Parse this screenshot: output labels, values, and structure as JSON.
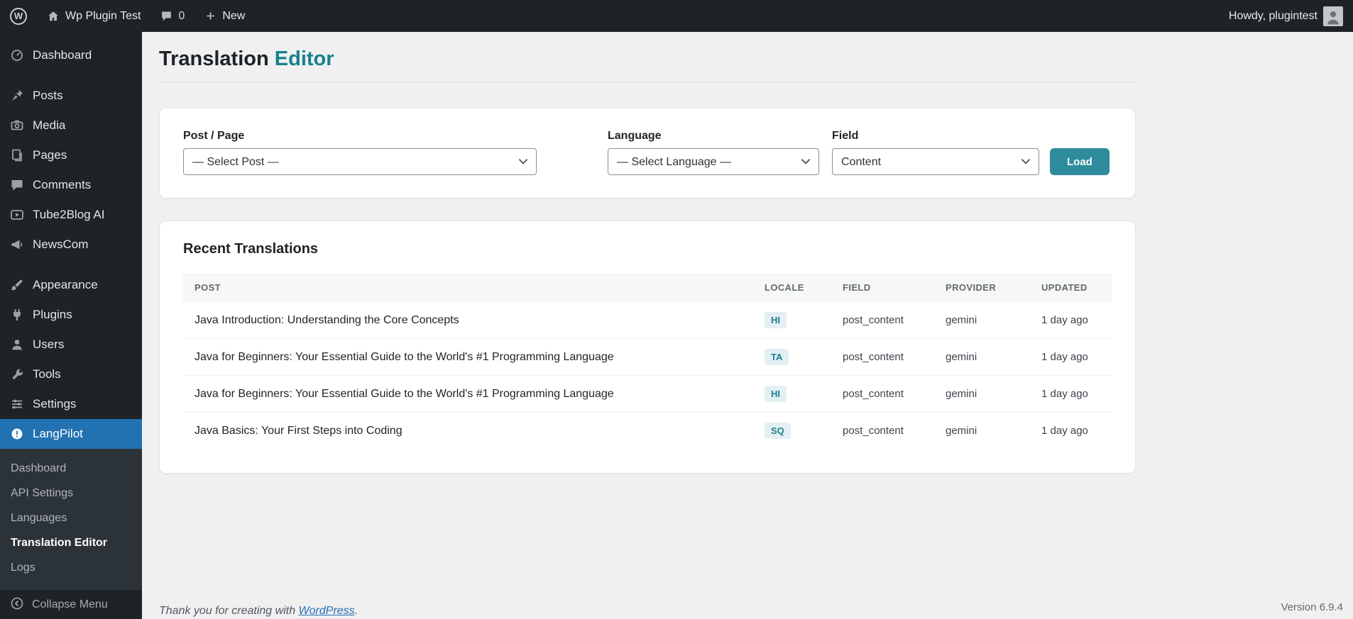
{
  "admin_bar": {
    "wp_logo_letter": "W",
    "site_name": "Wp Plugin Test",
    "comments_count": "0",
    "new_label": "New",
    "howdy": "Howdy, plugintest"
  },
  "sidebar": {
    "items": [
      {
        "label": "Dashboard"
      },
      {
        "label": "Posts"
      },
      {
        "label": "Media"
      },
      {
        "label": "Pages"
      },
      {
        "label": "Comments"
      },
      {
        "label": "Tube2Blog AI"
      },
      {
        "label": "NewsCom"
      },
      {
        "label": "Appearance"
      },
      {
        "label": "Plugins"
      },
      {
        "label": "Users"
      },
      {
        "label": "Tools"
      },
      {
        "label": "Settings"
      },
      {
        "label": "LangPilot"
      }
    ],
    "submenu": [
      "Dashboard",
      "API Settings",
      "Languages",
      "Translation Editor",
      "Logs"
    ],
    "active_item": "LangPilot",
    "active_submenu": "Translation Editor",
    "collapse_label": "Collapse Menu"
  },
  "page": {
    "title_part1": "Translation",
    "title_part2": "Editor"
  },
  "form": {
    "post_label": "Post / Page",
    "post_value": "— Select Post —",
    "language_label": "Language",
    "language_value": "— Select Language —",
    "field_label": "Field",
    "field_value": "Content",
    "load_button": "Load"
  },
  "table": {
    "title": "Recent Translations",
    "headers": [
      "POST",
      "LOCALE",
      "FIELD",
      "PROVIDER",
      "UPDATED"
    ],
    "rows": [
      {
        "post": "Java Introduction: Understanding the Core Concepts",
        "locale": "HI",
        "field": "post_content",
        "provider": "gemini",
        "updated": "1 day ago"
      },
      {
        "post": "Java for Beginners: Your Essential Guide to the World's #1 Programming Language",
        "locale": "TA",
        "field": "post_content",
        "provider": "gemini",
        "updated": "1 day ago"
      },
      {
        "post": "Java for Beginners: Your Essential Guide to the World's #1 Programming Language",
        "locale": "HI",
        "field": "post_content",
        "provider": "gemini",
        "updated": "1 day ago"
      },
      {
        "post": "Java Basics: Your First Steps into Coding",
        "locale": "SQ",
        "field": "post_content",
        "provider": "gemini",
        "updated": "1 day ago"
      }
    ]
  },
  "footer": {
    "thanks_prefix": "Thank you for creating with ",
    "wordpress_link": "WordPress",
    "thanks_suffix": ".",
    "version": "Version 6.9.4"
  },
  "colors": {
    "accent_teal": "#17808E",
    "button_teal": "#2E8C9C",
    "badge_bg": "#E3EFF3",
    "badge_text": "#1E7F90",
    "active_menu_blue": "#2271B1",
    "admin_dark": "#1D2327",
    "link_blue": "#2271B1",
    "content_bg": "#F0F0F1"
  },
  "icons": {
    "wordpress-logo-icon": "W-in-circle",
    "home-icon": "house",
    "comments-icon": "speech-bubble",
    "new-icon": "plus",
    "avatar": "person-photo",
    "dashboard-icon": "gauge",
    "posts-icon": "pushpin",
    "media-icon": "camera",
    "pages-icon": "stacked-pages",
    "comments-menu-icon": "speech-bubble",
    "tube2blog-icon": "video-play",
    "newscom-icon": "megaphone",
    "appearance-icon": "paintbrush",
    "plugins-icon": "plug",
    "users-icon": "person",
    "tools-icon": "wrench",
    "settings-icon": "sliders",
    "langpilot-icon": "warning-circle",
    "collapse-icon": "circle-left-arrow",
    "select-chevron-icon": "chevron-down"
  }
}
